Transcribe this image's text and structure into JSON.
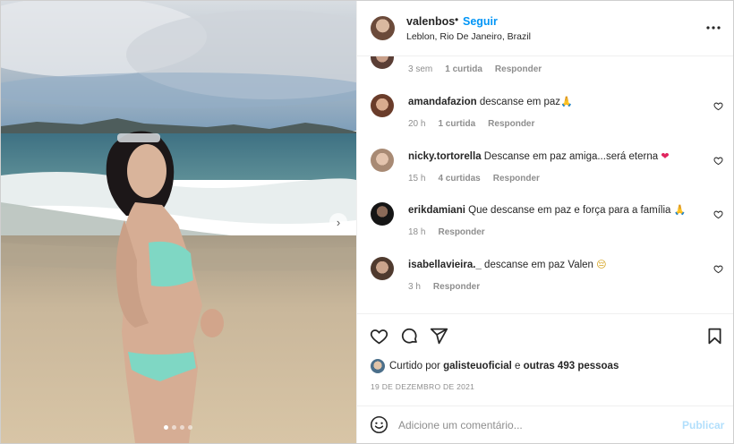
{
  "post": {
    "username": "valenbos",
    "separator": "•",
    "follow_label": "Seguir",
    "location": "Leblon, Rio De Janeiro, Brazil",
    "carousel_dots": 4,
    "carousel_active": 0
  },
  "comments": [
    {
      "username": "",
      "text": "",
      "time": "3 sem",
      "likes": "1 curtida",
      "reply": "Responder",
      "emoji": ""
    },
    {
      "username": "amandafazion",
      "text": "descanse em paz",
      "emoji": "🙏",
      "time": "20 h",
      "likes": "1 curtida",
      "reply": "Responder"
    },
    {
      "username": "nicky.tortorella",
      "text": "Descanse em paz amiga...será eterna",
      "emoji": "❤",
      "time": "15 h",
      "likes": "4 curtidas",
      "reply": "Responder"
    },
    {
      "username": "erikdamiani",
      "text": "Que descanse em paz e força para a família",
      "emoji": "🙏",
      "time": "18 h",
      "likes": "",
      "reply": "Responder"
    },
    {
      "username": "isabellavieira._",
      "text": "descanse em paz Valen",
      "emoji": "😔",
      "time": "3 h",
      "likes": "",
      "reply": "Responder"
    }
  ],
  "likes": {
    "prefix": "Curtido por",
    "user": "galisteuoficial",
    "middle": "e",
    "others": "outras 493 pessoas"
  },
  "date": "19 DE DEZEMBRO DE 2021",
  "add_comment": {
    "placeholder": "Adicione um comentário...",
    "publish_label": "Publicar"
  },
  "colors": {
    "link_blue": "#0095f6",
    "publish_disabled": "#b2dffc",
    "muted": "#8e8e8e",
    "heart_red": "#e0245e"
  },
  "icons": [
    "more-options-icon",
    "heart-icon",
    "comment-icon",
    "share-icon",
    "save-icon",
    "emoji-icon",
    "next-arrow-icon"
  ]
}
